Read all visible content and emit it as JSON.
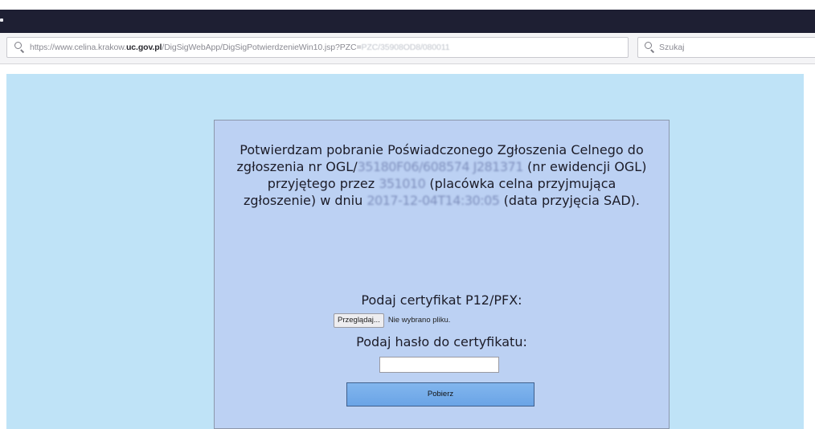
{
  "browser": {
    "url_prefix": "https://www.celina.krakow.",
    "url_domain": "uc.gov.pl",
    "url_path": "/DigSigWebApp/DigSigPotwierdzenieWin10.jsp?PZC=",
    "url_obscured": "PZC/35908OD8/080011",
    "search_placeholder": "Szukaj"
  },
  "form": {
    "message_part1": "Potwierdzam pobranie Poświadczonego Zgłoszenia Celnego do zgłoszenia nr OGL/",
    "message_blur1": "35180F06/608574 J281371",
    "message_part2": " (nr ewidencji OGL) przyjętego przez ",
    "message_blur2": "351010",
    "message_part3": " (placówka celna przyjmująca zgłoszenie) w dniu ",
    "message_blur3": "2017-12-04T14:30:05",
    "message_part4": " (data przyjęcia SAD).",
    "cert_label": "Podaj certyfikat P12/PFX:",
    "browse_label": "Przeglądaj...",
    "no_file_label": "Nie wybrano pliku.",
    "password_label": "Podaj hasło do certyfikatu:",
    "password_value": "",
    "submit_label": "Pobierz"
  },
  "colors": {
    "titlebar": "#1e1f33",
    "page_background": "#bfe3f7",
    "panel_background": "#bcd1f3",
    "button": "#6aa4e6"
  }
}
